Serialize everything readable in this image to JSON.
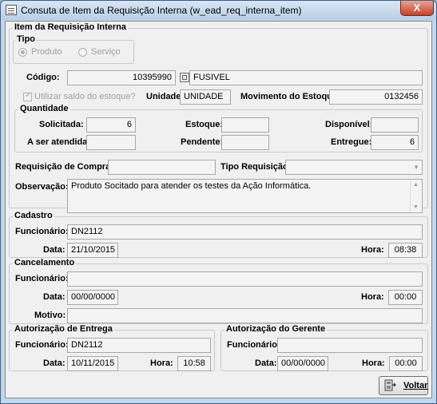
{
  "window": {
    "title": "Consuta de Item da Requisição Interna (w_ead_req_interna_item)",
    "close": "X"
  },
  "item": {
    "group_title": "Item da Requisição Interna",
    "tipo": {
      "title": "Tipo",
      "produto": "Produto",
      "servico": "Serviço"
    },
    "codigo_label": "Código:",
    "codigo_value": "10395990",
    "descricao_value": "FUSIVEL",
    "utilizar_saldo_label": "Utilizar saldo do estoque?",
    "unidade_label": "Unidade:",
    "unidade_value": "UNIDADE",
    "movimento_label": "Movimento do Estoque:",
    "movimento_value": "0132456",
    "quantidade": {
      "title": "Quantidade",
      "solicitada_label": "Solicitada:",
      "solicitada_value": "6",
      "estoque_label": "Estoque:",
      "estoque_value": "",
      "disponivel_label": "Disponível:",
      "disponivel_value": "",
      "ser_atendida_label": "A ser atendida:",
      "ser_atendida_value": "",
      "pendente_label": "Pendente:",
      "pendente_value": "",
      "entregue_label": "Entregue:",
      "entregue_value": "6"
    },
    "requisicao_compra_label": "Requisição de Compra:",
    "requisicao_compra_value": "",
    "tipo_requisicao_label": "Tipo Requisição:",
    "tipo_requisicao_value": "",
    "observacao_label": "Observação:",
    "observacao_value": "Produto Socitado para atender os testes da Ação Informática."
  },
  "cadastro": {
    "title": "Cadastro",
    "funcionario_label": "Funcionário:",
    "funcionario_value": "DN2112",
    "data_label": "Data:",
    "data_value": "21/10/2015",
    "hora_label": "Hora:",
    "hora_value": "08:38"
  },
  "cancelamento": {
    "title": "Cancelamento",
    "funcionario_label": "Funcionário:",
    "funcionario_value": "",
    "data_label": "Data:",
    "data_value": "00/00/0000",
    "hora_label": "Hora:",
    "hora_value": "00:00",
    "motivo_label": "Motivo:",
    "motivo_value": ""
  },
  "autorizacao_entrega": {
    "title": "Autorização de Entrega",
    "funcionario_label": "Funcionário:",
    "funcionario_value": "DN2112",
    "data_label": "Data:",
    "data_value": "10/11/2015",
    "hora_label": "Hora:",
    "hora_value": "10:58"
  },
  "autorizacao_gerente": {
    "title": "Autorização do Gerente",
    "funcionario_label": "Funcionário:",
    "funcionario_value": "",
    "data_label": "Data:",
    "data_value": "00/00/0000",
    "hora_label": "Hora:",
    "hora_value": "00:00"
  },
  "buttons": {
    "voltar": "Voltar"
  },
  "icons": {
    "lookup": "lookup-icon",
    "voltar": "exit-door-icon",
    "window": "form-icon"
  },
  "colors": {
    "titlebar": "#c3d6ea",
    "close": "#c7412a",
    "panel": "#f0f0f0"
  }
}
